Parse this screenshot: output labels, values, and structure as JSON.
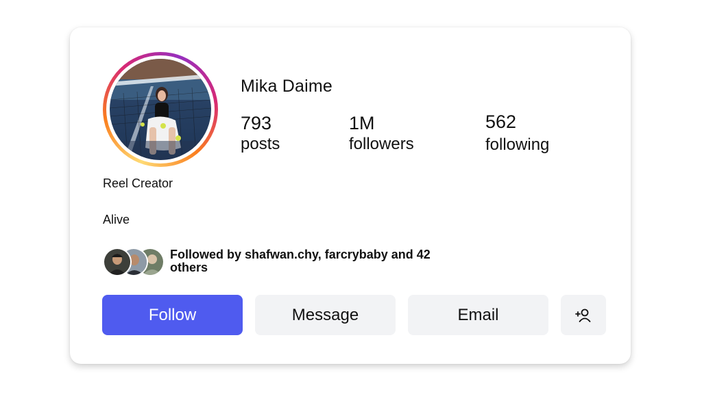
{
  "profile": {
    "name": "Mika Daime",
    "role": "Reel Creator",
    "bio": "Alive"
  },
  "stats": {
    "posts": {
      "value": "793",
      "label": "posts"
    },
    "followers": {
      "value": "1M",
      "label": "followers"
    },
    "following": {
      "value": "562",
      "label": "following"
    }
  },
  "followed_by": {
    "text": "Followed by shafwan.chy, farcrybaby and 42 others"
  },
  "actions": {
    "follow": "Follow",
    "message": "Message",
    "email": "Email",
    "add_friend_icon": "add-person-icon"
  },
  "colors": {
    "primary": "#4f5bef",
    "secondary_button": "#f2f3f5",
    "story_ring": [
      "#feda75",
      "#fa7e1e",
      "#d62976",
      "#962fbf"
    ]
  }
}
